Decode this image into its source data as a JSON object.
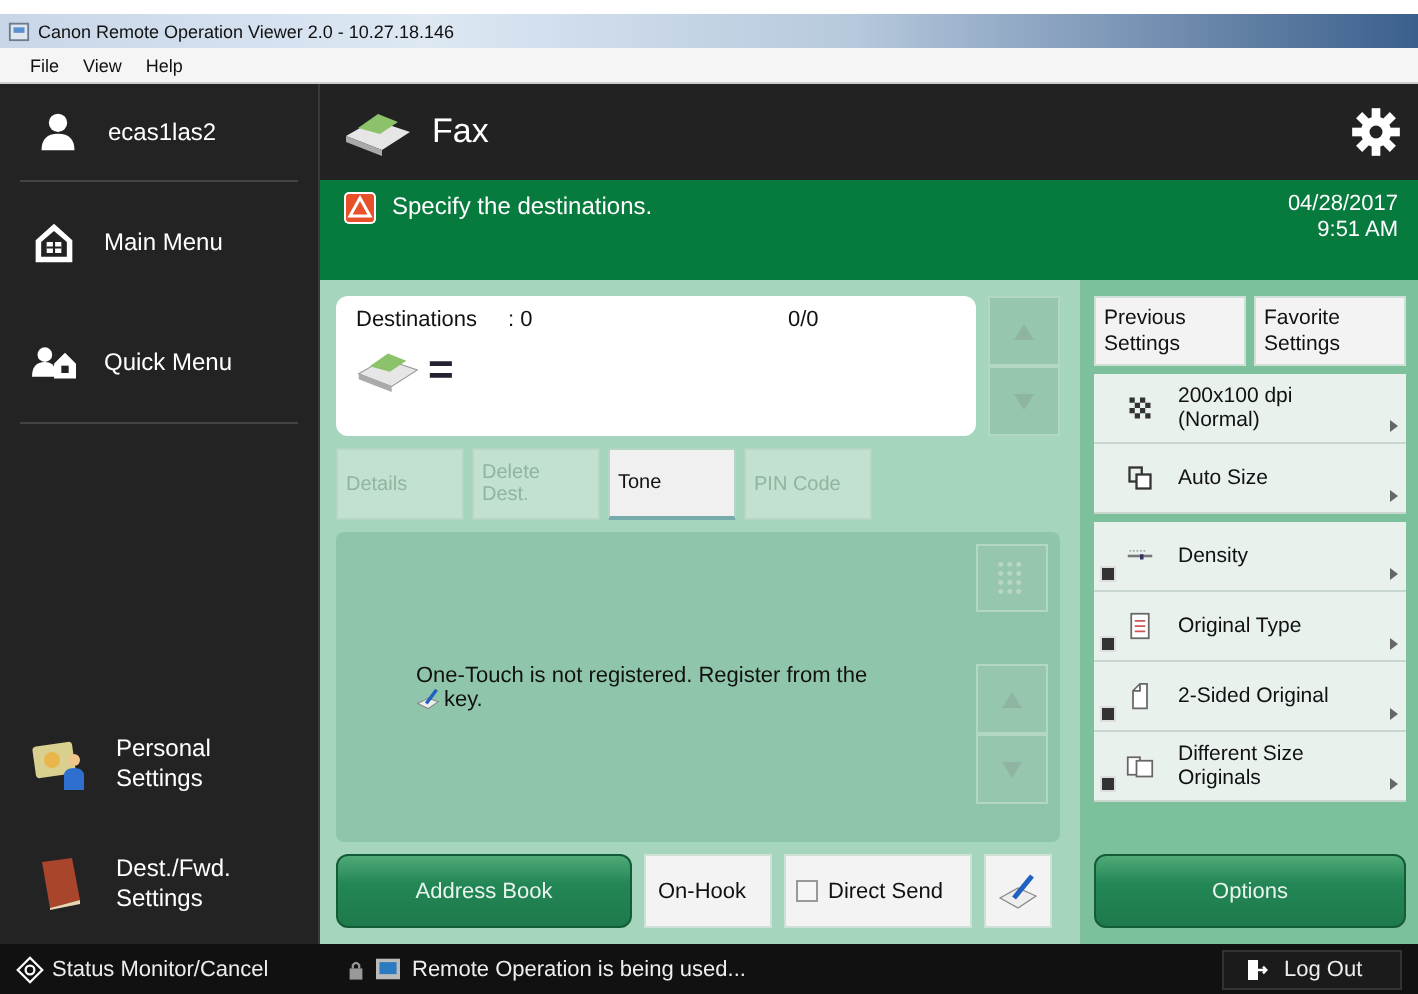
{
  "window": {
    "title": "Canon Remote Operation Viewer 2.0 - 10.27.18.146"
  },
  "menu": [
    "File",
    "View",
    "Help"
  ],
  "sidebar": {
    "user": "ecas1las2",
    "items": [
      {
        "lines": [
          "Main Menu"
        ]
      },
      {
        "lines": [
          "Quick Menu"
        ]
      },
      {
        "lines": [
          "Personal",
          "Settings"
        ]
      },
      {
        "lines": [
          "Dest./Fwd.",
          "Settings"
        ]
      }
    ]
  },
  "header": {
    "title": "Fax"
  },
  "message": {
    "text": "Specify the destinations.",
    "date": "04/28/2017",
    "time": "9:51 AM"
  },
  "destinations": {
    "label": "Destinations",
    "count": ": 0",
    "pages": "0/0",
    "symbol": "="
  },
  "dest_buttons": [
    {
      "lines": [
        "Details"
      ],
      "disabled": true
    },
    {
      "lines": [
        "Delete",
        "Dest."
      ],
      "disabled": true
    },
    {
      "lines": [
        "Tone"
      ],
      "disabled": false
    },
    {
      "lines": [
        "PIN Code"
      ],
      "disabled": true
    }
  ],
  "one_touch": {
    "text": "One-Touch is not registered. Register from the",
    "text_end": "key."
  },
  "bottom": {
    "address_book": "Address Book",
    "on_hook": "On-Hook",
    "direct_send": {
      "label": "Direct Send",
      "checked": false
    }
  },
  "settings_top": [
    {
      "lines": [
        "Previous",
        "Settings"
      ]
    },
    {
      "lines": [
        "Favorite",
        "Settings"
      ]
    }
  ],
  "settings_groups": [
    [
      {
        "lines": [
          "200x100 dpi",
          "(Normal)"
        ],
        "shortcut": false
      },
      {
        "lines": [
          "Auto Size"
        ],
        "shortcut": false
      }
    ],
    [
      {
        "lines": [
          "Density"
        ],
        "shortcut": true
      },
      {
        "lines": [
          "Original Type"
        ],
        "shortcut": true
      },
      {
        "lines": [
          "2-Sided Original"
        ],
        "shortcut": true
      },
      {
        "lines": [
          "Different Size",
          "Originals"
        ],
        "shortcut": true
      }
    ]
  ],
  "options": "Options",
  "status_bar": {
    "left": "Status Monitor/Cancel",
    "message": "Remote Operation is being used...",
    "logout": "Log Out"
  }
}
